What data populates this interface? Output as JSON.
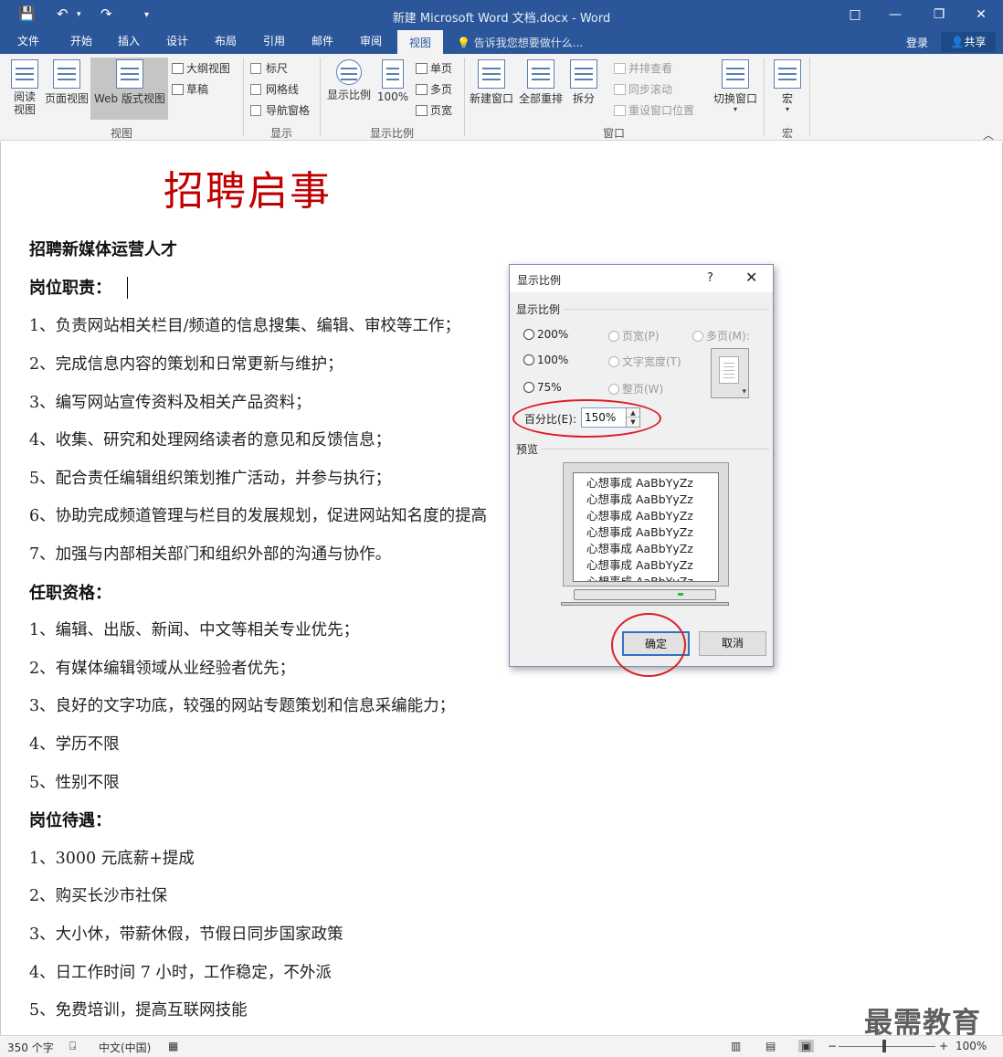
{
  "window": {
    "title": "新建 Microsoft Word 文档.docx - Word",
    "controls": [
      "□",
      "—",
      "❐",
      "✕"
    ]
  },
  "quick_access": {
    "save_icon": "save-icon",
    "undo_icon": "undo-icon",
    "redo_icon": "redo-icon"
  },
  "tabs": [
    "文件",
    "开始",
    "插入",
    "设计",
    "布局",
    "引用",
    "邮件",
    "审阅",
    "视图"
  ],
  "active_tab": "视图",
  "tell_me": "告诉我您想要做什么...",
  "account": {
    "login": "登录",
    "share": "共享"
  },
  "ribbon": {
    "views": {
      "read": "阅读视图",
      "print": "页面视图",
      "web": "Web 版式视图",
      "outline": "大纲视图",
      "draft": "草稿",
      "group": "视图"
    },
    "show": {
      "ruler": "标尺",
      "gridlines": "网格线",
      "nav_pane": "导航窗格",
      "group": "显示"
    },
    "zoom": {
      "zoom": "显示比例",
      "hundred": "100%",
      "one_page": "单页",
      "multi_page": "多页",
      "page_width": "页宽",
      "group": "显示比例"
    },
    "window": {
      "new_window": "新建窗口",
      "arrange_all": "全部重排",
      "split": "拆分",
      "side_by_side": "并排查看",
      "sync_scroll": "同步滚动",
      "reset_position": "重设窗口位置",
      "switch_window": "切换窗口",
      "group": "窗口"
    },
    "macros": {
      "macros": "宏",
      "group": "宏"
    }
  },
  "document": {
    "title": "招聘启事",
    "paragraphs": [
      {
        "text": "招聘新媒体运营人才",
        "bold": true
      },
      {
        "text": "岗位职责：",
        "bold": true
      },
      {
        "text": "1、负责网站相关栏目/频道的信息搜集、编辑、审校等工作；",
        "bold": false
      },
      {
        "text": "2、完成信息内容的策划和日常更新与维护；",
        "bold": false
      },
      {
        "text": "3、编写网站宣传资料及相关产品资料；",
        "bold": false
      },
      {
        "text": "4、收集、研究和处理网络读者的意见和反馈信息；",
        "bold": false
      },
      {
        "text": "5、配合责任编辑组织策划推广活动，并参与执行；",
        "bold": false
      },
      {
        "text": "6、协助完成频道管理与栏目的发展规划，促进网站知名度的提高",
        "bold": false
      },
      {
        "text": "7、加强与内部相关部门和组织外部的沟通与协作。",
        "bold": false
      },
      {
        "text": "任职资格：",
        "bold": true
      },
      {
        "text": "1、编辑、出版、新闻、中文等相关专业优先；",
        "bold": false
      },
      {
        "text": "2、有媒体编辑领域从业经验者优先；",
        "bold": false
      },
      {
        "text": "3、良好的文字功底，较强的网站专题策划和信息采编能力；",
        "bold": false
      },
      {
        "text": "4、学历不限",
        "bold": false
      },
      {
        "text": "5、性别不限",
        "bold": false
      },
      {
        "text": "岗位待遇：",
        "bold": true
      },
      {
        "text": "1、3000 元底薪+提成",
        "bold": false
      },
      {
        "text": "2、购买长沙市社保",
        "bold": false
      },
      {
        "text": "3、大小休，带薪休假，节假日同步国家政策",
        "bold": false
      },
      {
        "text": "4、日工作时间 7 小时，工作稳定，不外派",
        "bold": false
      },
      {
        "text": "5、免费培训，提高互联网技能",
        "bold": false
      }
    ]
  },
  "dialog": {
    "title": "显示比例",
    "help": "?",
    "close": "✕",
    "zoom_section": "显示比例",
    "options": {
      "z200": "200%",
      "z100": "100%",
      "z75": "75%",
      "page_width": "页宽(P)",
      "text_width": "文字宽度(T)",
      "whole_page": "整页(W)",
      "many_pages": "多页(M):"
    },
    "percent_label": "百分比(E):",
    "percent_value": "150%",
    "preview_label": "预览",
    "preview_lines": [
      "心想事成 AaBbYyZz",
      "心想事成 AaBbYyZz",
      "心想事成 AaBbYyZz",
      "心想事成 AaBbYyZz",
      "心想事成 AaBbYyZz",
      "心想事成 AaBbYyZz",
      "心想事成 AaBbYyZz"
    ],
    "ok": "确定",
    "cancel": "取消"
  },
  "status": {
    "word_count": "350 个字",
    "language": "中文(中国)",
    "zoom": "100%",
    "zoom_minus": "−",
    "zoom_plus": "+"
  },
  "watermark": "最需教育",
  "colors": {
    "brand": "#2b579a",
    "title_red": "#c00000",
    "annotation_red": "#d9202a"
  }
}
